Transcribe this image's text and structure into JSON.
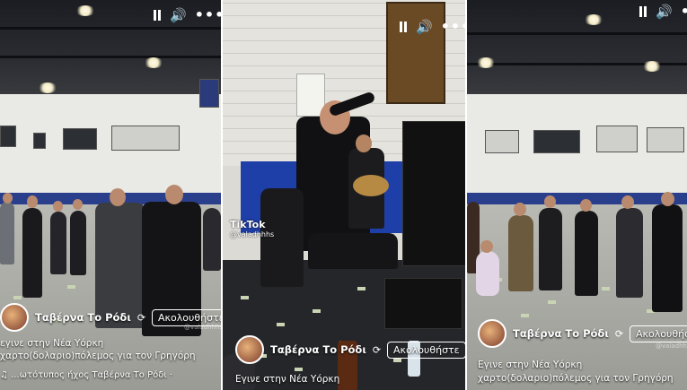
{
  "controls": {
    "pause_icon": "pause-icon",
    "volume_icon": "volume-icon",
    "more_icon": "more-icon",
    "volume_glyph": "🔊",
    "more_glyph": "•••"
  },
  "panel_left": {
    "account_name": "Ταβέρνα Το Ρόδι",
    "follow_label": "Ακολουθήστε",
    "caption_line1": "εγινε στην Νέα Υόρκη",
    "caption_line2": "χαρτο(δολαριο)πόλεμος για τον Γρηγόρη",
    "music_line": "♫ ...ωτότυπος ήχος   Ταβέρνα Το Ρόδι ·",
    "watermark": "@valadhhhs"
  },
  "panel_center": {
    "tiktok_label": "TikTok",
    "tiktok_handle": "@valadhhhs",
    "account_name": "Ταβέρνα Το Ρόδι",
    "follow_label": "Ακολουθήστε",
    "caption_line1": "Εγινε στην Νέα Υόρκη"
  },
  "panel_right": {
    "account_name": "Ταβέρνα Το Ρόδι",
    "follow_label": "Ακολουθήστε",
    "caption_line1": "Εγινε στην Νέα Υόρκη",
    "caption_line2": "χαρτο(δολαριο)πόλεμος για τον Γρηγόρη",
    "watermark": "@valadhhhs"
  },
  "colors": {
    "court_blue": "#2a3f8c",
    "stage_blue": "#1f3fa8",
    "text": "#ffffff"
  }
}
